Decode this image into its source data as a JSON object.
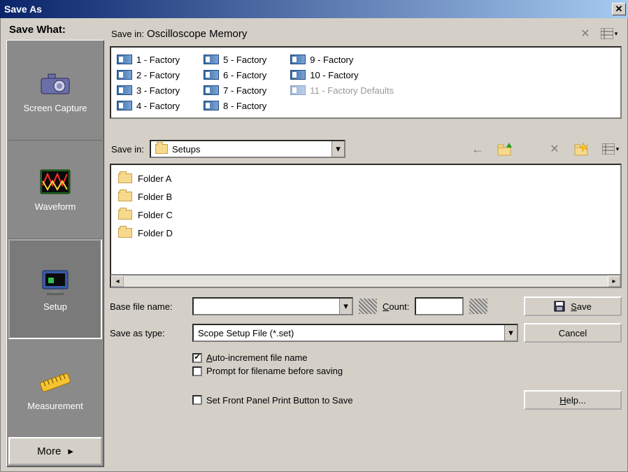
{
  "title": "Save As",
  "sidebar": {
    "heading": "Save What:",
    "items": [
      {
        "label": "Screen Capture",
        "icon": "camera-icon"
      },
      {
        "label": "Waveform",
        "icon": "waveform-icon"
      },
      {
        "label": "Setup",
        "icon": "setup-icon"
      },
      {
        "label": "Measurement",
        "icon": "measurement-icon"
      }
    ],
    "selected_index": 2,
    "more_label": "More"
  },
  "memory": {
    "label": "Save in:",
    "location": "Oscilloscope Memory",
    "entries": [
      {
        "label": "1 - Factory"
      },
      {
        "label": "2 - Factory"
      },
      {
        "label": "3 - Factory"
      },
      {
        "label": "4 - Factory"
      },
      {
        "label": "5 - Factory"
      },
      {
        "label": "6 - Factory"
      },
      {
        "label": "7 - Factory"
      },
      {
        "label": "8 - Factory"
      },
      {
        "label": "9 - Factory"
      },
      {
        "label": "10 - Factory"
      },
      {
        "label": "11 - Factory Defaults",
        "disabled": true
      }
    ]
  },
  "file_browser": {
    "label": "Save in:",
    "location": "Setups",
    "folders": [
      "Folder A",
      "Folder B",
      "Folder C",
      "Folder D"
    ]
  },
  "form": {
    "base_name_label": "Base file name:",
    "base_name_value": "",
    "count_label": "Count:",
    "count_value": "",
    "type_label": "Save as type:",
    "type_value": "Scope Setup File (*.set)"
  },
  "options": {
    "auto_increment": {
      "label": "Auto-increment file name",
      "checked": true
    },
    "prompt": {
      "label": "Prompt for filename before saving",
      "checked": false
    },
    "front_panel": {
      "label": "Set Front Panel Print Button to Save",
      "checked": false
    }
  },
  "buttons": {
    "save": "Save",
    "cancel": "Cancel",
    "help": "Help..."
  }
}
